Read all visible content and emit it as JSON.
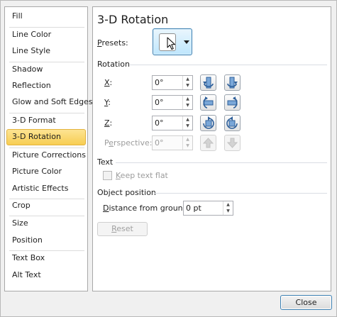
{
  "sidebar": {
    "items": [
      {
        "label": "Fill"
      },
      {
        "label": "Line Color"
      },
      {
        "label": "Line Style"
      },
      {
        "label": "Shadow"
      },
      {
        "label": "Reflection"
      },
      {
        "label": "Glow and Soft Edges"
      },
      {
        "label": "3-D Format"
      },
      {
        "label": "3-D Rotation"
      },
      {
        "label": "Picture Corrections"
      },
      {
        "label": "Picture Color"
      },
      {
        "label": "Artistic Effects"
      },
      {
        "label": "Crop"
      },
      {
        "label": "Size"
      },
      {
        "label": "Position"
      },
      {
        "label": "Text Box"
      },
      {
        "label": "Alt Text"
      }
    ],
    "selected": "3-D Rotation"
  },
  "panel": {
    "title": "3-D Rotation",
    "presets": {
      "label_pre": "",
      "label_u": "P",
      "label_post": "resets:"
    },
    "rotation": {
      "heading": "Rotation",
      "x": {
        "label_u": "X",
        "label_post": ":",
        "value": "0°"
      },
      "y": {
        "label_u": "Y",
        "label_post": ":",
        "value": "0°"
      },
      "z": {
        "label_u": "Z",
        "label_post": ":",
        "value": "0°"
      },
      "perspective": {
        "label_pre": "P",
        "label_u": "e",
        "label_post": "rspective:",
        "value": "0°"
      }
    },
    "text": {
      "heading": "Text",
      "keep_flat": {
        "label_u": "K",
        "label_post": "eep text flat",
        "checked": false
      }
    },
    "object_position": {
      "heading": "Object position",
      "distance": {
        "label_u": "D",
        "label_post": "istance from ground:",
        "value": "0 pt"
      }
    },
    "reset": {
      "label_u": "R",
      "label_post": "eset"
    }
  },
  "footer": {
    "close_label": "Close"
  }
}
